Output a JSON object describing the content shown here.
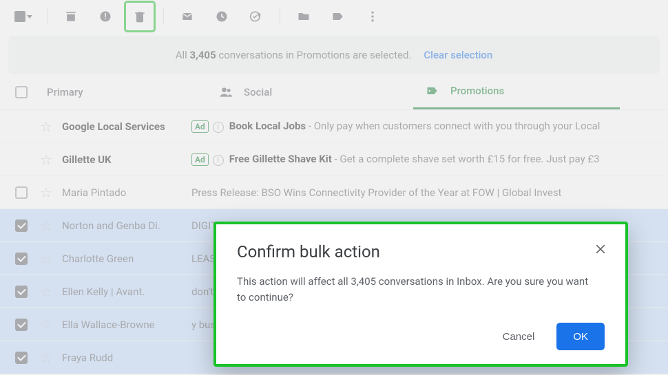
{
  "toolbar": {
    "icons": [
      "select",
      "archive",
      "spam",
      "delete",
      "mark-read",
      "snooze",
      "task",
      "move",
      "label",
      "more"
    ]
  },
  "banner": {
    "prefix": "All ",
    "count": "3,405",
    "suffix": " conversations in Promotions are selected.",
    "clear": "Clear selection"
  },
  "tabs": {
    "primary": "Primary",
    "social": "Social",
    "promotions": "Promotions"
  },
  "rows": [
    {
      "checked": false,
      "showCheck": false,
      "sender": "Google Local Services",
      "ad": true,
      "boldSender": true,
      "subjectBold": "Book Local Jobs",
      "subjectRest": " - Only pay when customers connect with you through your Local"
    },
    {
      "checked": false,
      "showCheck": false,
      "sender": "Gillette UK",
      "ad": true,
      "boldSender": true,
      "subjectBold": "Free Gillette Shave Kit",
      "subjectRest": " - Get a complete shave set worth £15 for free. Just pay £3"
    },
    {
      "checked": false,
      "showCheck": true,
      "sender": "Maria Pintado",
      "ad": false,
      "boldSender": false,
      "subjectBold": "",
      "subjectRest": "Press Release: BSO Wins Connectivity Provider of the Year  at FOW | Global Invest"
    },
    {
      "checked": true,
      "showCheck": true,
      "sender": "Norton and Genba Di.",
      "ad": false,
      "boldSender": false,
      "subjectBold": "",
      "subjectRest": "DIGITAL"
    },
    {
      "checked": true,
      "showCheck": true,
      "sender": "Charlotte Green",
      "ad": false,
      "boldSender": false,
      "subjectBold": "",
      "subjectRest": "LEASE P"
    },
    {
      "checked": true,
      "showCheck": true,
      "sender": "Ellen Kelly | Avant.",
      "ad": false,
      "boldSender": false,
      "subjectBold": "",
      "subjectRest": "don't he"
    },
    {
      "checked": true,
      "showCheck": true,
      "sender": "Ella Wallace-Browne",
      "ad": false,
      "boldSender": false,
      "subjectBold": "",
      "subjectRest": "y busine"
    },
    {
      "checked": true,
      "showCheck": true,
      "sender": "Fraya Rudd",
      "ad": false,
      "boldSender": false,
      "subjectBold": "",
      "subjectRest": ""
    }
  ],
  "dialog": {
    "title": "Confirm bulk action",
    "body": "This action will affect all 3,405 conversations in Inbox. Are you sure you want to continue?",
    "cancel": "Cancel",
    "ok": "OK"
  }
}
